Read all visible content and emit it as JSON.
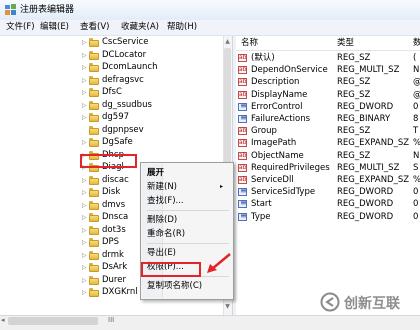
{
  "window": {
    "title": "注册表编辑器"
  },
  "menu": [
    "文件(F)",
    "编辑(E)",
    "查看(V)",
    "收藏夹(A)",
    "帮助(H)"
  ],
  "tree": {
    "items": [
      {
        "label": "CscService",
        "arrow": "▷"
      },
      {
        "label": "DCLocator",
        "arrow": "▷"
      },
      {
        "label": "DcomLaunch",
        "arrow": "▷"
      },
      {
        "label": "defragsvc",
        "arrow": "▷"
      },
      {
        "label": "DfsC",
        "arrow": "▷"
      },
      {
        "label": "dg_ssudbus",
        "arrow": "▷"
      },
      {
        "label": "dg597",
        "arrow": "▷"
      },
      {
        "label": "dgpnpsev",
        "arrow": ""
      },
      {
        "label": "DgSafe",
        "arrow": "▷"
      },
      {
        "label": "Dhcp",
        "arrow": "▷"
      },
      {
        "label": "Diagl",
        "arrow": "▷"
      },
      {
        "label": "discac",
        "arrow": "▷"
      },
      {
        "label": "Disk",
        "arrow": "▷"
      },
      {
        "label": "dmvs",
        "arrow": "▷"
      },
      {
        "label": "Dnsca",
        "arrow": "▷"
      },
      {
        "label": "dot3s",
        "arrow": "▷"
      },
      {
        "label": "DPS",
        "arrow": "▷"
      },
      {
        "label": "drmk",
        "arrow": "▷"
      },
      {
        "label": "DsArk",
        "arrow": "▷"
      },
      {
        "label": "Durer",
        "arrow": "▷"
      },
      {
        "label": "DXGKrnl",
        "arrow": "▷"
      }
    ],
    "scroll_up": "▲",
    "scroll_down": "▼"
  },
  "list": {
    "headers": {
      "name": "名称",
      "type": "类型",
      "data": "数"
    },
    "rows": [
      {
        "name": "(默认)",
        "type": "REG_SZ",
        "data": "(",
        "icon": "string"
      },
      {
        "name": "DependOnService",
        "type": "REG_MULTI_SZ",
        "data": "N",
        "icon": "string"
      },
      {
        "name": "Description",
        "type": "REG_SZ",
        "data": "@",
        "icon": "string"
      },
      {
        "name": "DisplayName",
        "type": "REG_SZ",
        "data": "@",
        "icon": "string"
      },
      {
        "name": "ErrorControl",
        "type": "REG_DWORD",
        "data": "0",
        "icon": "binary"
      },
      {
        "name": "FailureActions",
        "type": "REG_BINARY",
        "data": "8",
        "icon": "binary"
      },
      {
        "name": "Group",
        "type": "REG_SZ",
        "data": "T",
        "icon": "string"
      },
      {
        "name": "ImagePath",
        "type": "REG_EXPAND_SZ",
        "data": "%",
        "icon": "string"
      },
      {
        "name": "ObjectName",
        "type": "REG_SZ",
        "data": "N",
        "icon": "string"
      },
      {
        "name": "RequiredPrivileges",
        "type": "REG_MULTI_SZ",
        "data": "S",
        "icon": "string"
      },
      {
        "name": "ServiceDll",
        "type": "REG_EXPAND_SZ",
        "data": "%",
        "icon": "string"
      },
      {
        "name": "ServiceSidType",
        "type": "REG_DWORD",
        "data": "0",
        "icon": "binary"
      },
      {
        "name": "Start",
        "type": "REG_DWORD",
        "data": "0",
        "icon": "binary"
      },
      {
        "name": "Type",
        "type": "REG_DWORD",
        "data": "0",
        "icon": "binary"
      }
    ]
  },
  "context_menu": {
    "items": [
      {
        "label": "展开",
        "bold": true
      },
      {
        "label": "新建(N)",
        "submenu": true
      },
      {
        "label": "查找(F)...",
        "sep_after": true
      },
      {
        "label": "删除(D)"
      },
      {
        "label": "重命名(R)",
        "sep_after": true
      },
      {
        "label": "导出(E)"
      },
      {
        "label": "权限(P)...",
        "highlighted": true,
        "sep_after": true
      },
      {
        "label": "复制项名称(C)"
      }
    ],
    "submenu_glyph": "▸"
  },
  "scrollbar": {
    "left": "◂",
    "label": "III"
  },
  "watermark": {
    "text": "创新互联"
  },
  "colors": {
    "highlight_red": "#e3242b",
    "folder": "#e9c24c"
  }
}
